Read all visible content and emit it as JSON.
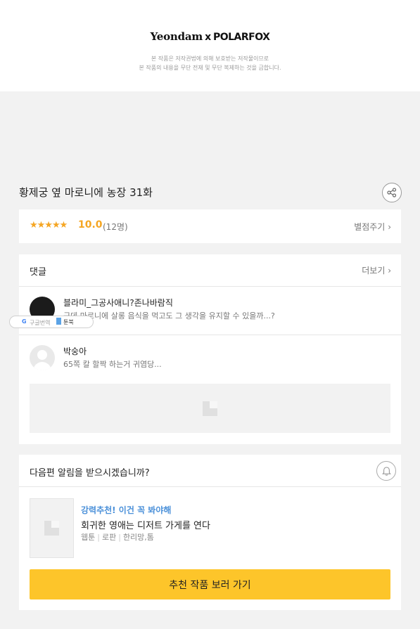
{
  "banner": {
    "brand_left": "Yeondam",
    "brand_x": "x",
    "brand_right": "POLARFOX",
    "copyright_line1": "본 작품은 저작권법에 의해 보호받는 저작물이므로",
    "copyright_line2": "본 작품의 내용을 무단 전재 및 무단 복제하는 것을 금합니다."
  },
  "episode": {
    "title": "황제궁 옆 마로니에 농장 31화",
    "share_icon": "share-icon"
  },
  "rating": {
    "stars": "★★★★★",
    "score": "10.0",
    "count": "(12명)",
    "rate_link": "별점주기",
    "star_value": 5,
    "accent_color": "#f5a623"
  },
  "comments": {
    "title": "댓글",
    "more_link": "더보기",
    "items": [
      {
        "name": "블라미_그공사애니?존나바람직",
        "text": "근데 마로니에 살롱 음식을 먹고도 그 생각을 유지할 수 있을까...?"
      },
      {
        "name": "박숭아",
        "text": "65쪽 칼 할짝 하는거 귀염당..."
      }
    ]
  },
  "overlay_badge": {
    "google": "G",
    "label1": "구글번역",
    "label2": "툰북"
  },
  "notify": {
    "title": "다음편 알림을 받으시겠습니까?",
    "bell_icon": "bell-icon",
    "rec_label": "강력추천! 이건 꼭 봐야해",
    "rec_title": "회귀한 영애는 디저트 가게를 연다",
    "rec_meta": [
      "웹툰",
      "로판",
      "한리망,톰"
    ],
    "cta_label": "추천 작품 보러 가기",
    "label_color": "#4a90d9",
    "cta_color": "#fdc52a"
  }
}
